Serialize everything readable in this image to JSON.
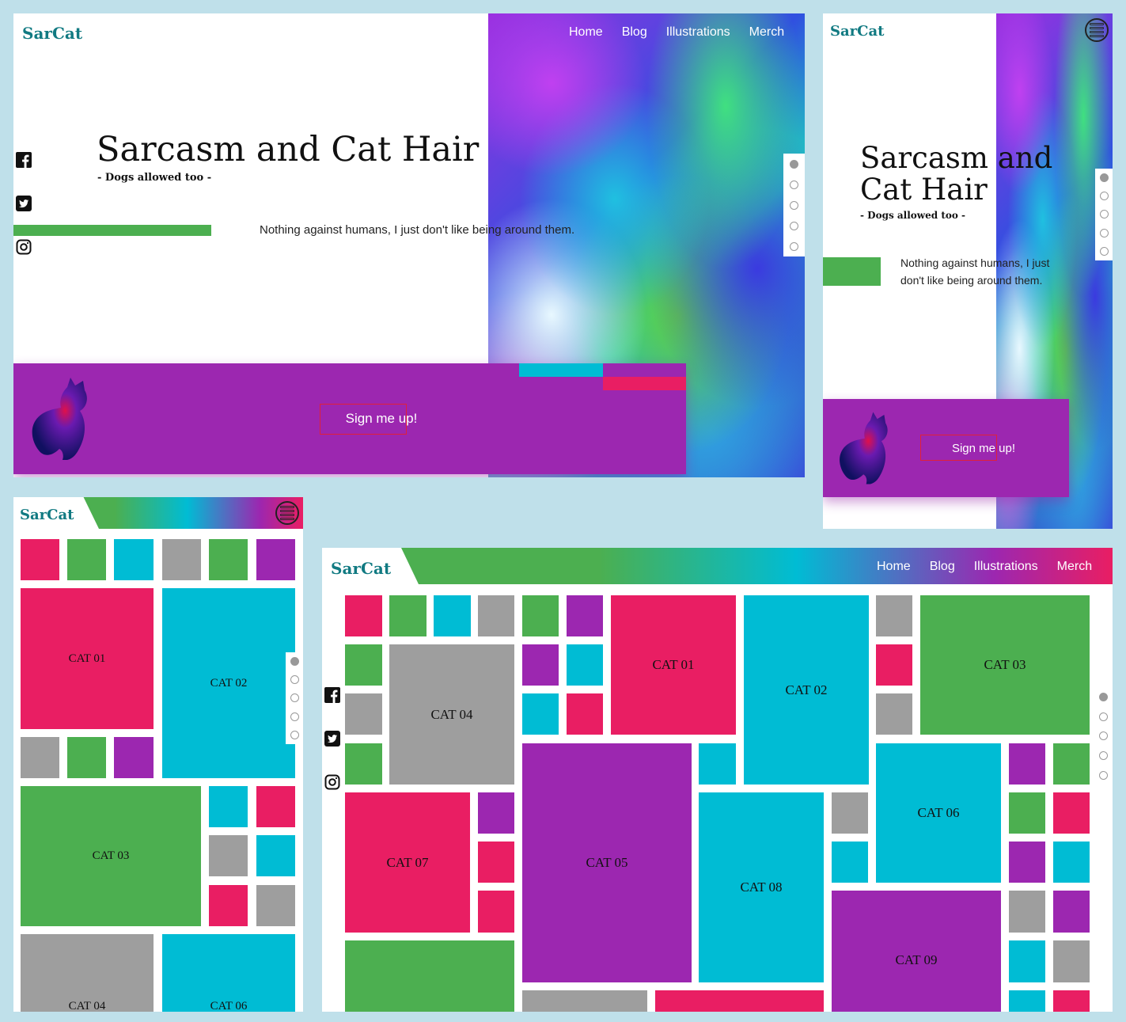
{
  "brand": "SarCat",
  "nav": [
    "Home",
    "Blog",
    "Illustrations",
    "Merch"
  ],
  "hero": {
    "title": "Sarcasm and Cat Hair",
    "title_line1": "Sarcasm and",
    "title_line2": "Cat Hair",
    "subtitle": "- Dogs allowed too -",
    "tagline": "Nothing against humans, I just don't like being around them.",
    "tagline_line1": "Nothing against humans, I just",
    "tagline_line2": "don't like being around them."
  },
  "signup": {
    "label": "Sign me up!"
  },
  "social_icons": [
    "facebook-icon",
    "twitter-icon",
    "instagram-icon"
  ],
  "page_dots": {
    "count": 5,
    "active_index": 0
  },
  "gallery_tiles": [
    "CAT 01",
    "CAT 02",
    "CAT 03",
    "CAT 04",
    "CAT 05",
    "CAT 06",
    "CAT 07",
    "CAT 08",
    "CAT 09"
  ],
  "colors": {
    "background": "#bfe0ea",
    "logo": "#117a82",
    "pink": "#e91e63",
    "cyan": "#00bcd4",
    "green": "#4caf50",
    "grey": "#9e9e9e",
    "purple": "#9c27b0"
  }
}
